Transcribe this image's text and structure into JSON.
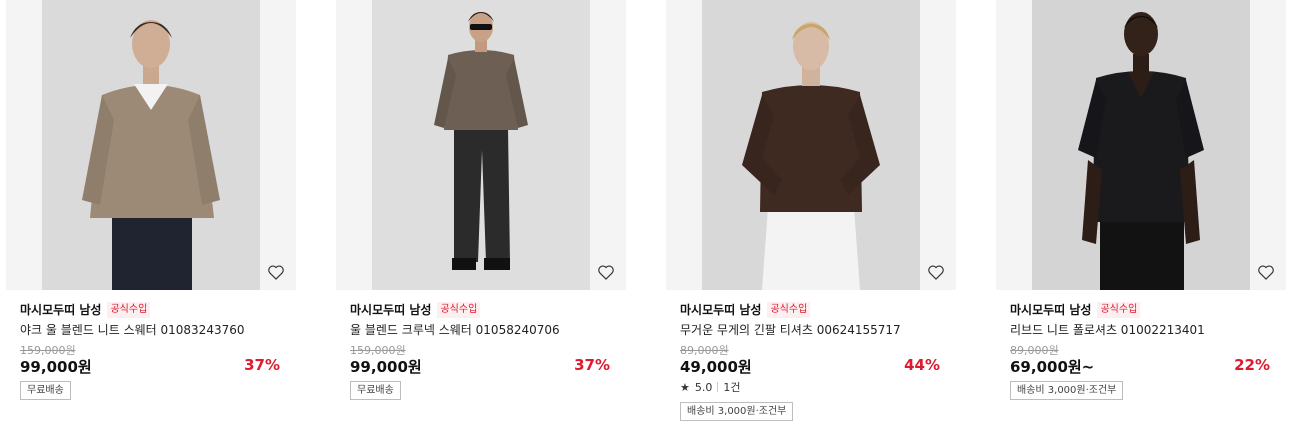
{
  "products": [
    {
      "brand": "마시모두띠 남성",
      "badge": "공식수입",
      "title": "야크 울 블렌드 니트 스웨터 01083243760",
      "original_price": "159,000원",
      "price": "99,000원",
      "discount": "37%",
      "shipping_tag": "무료배송",
      "wishlist_icon": "heart-outline-icon"
    },
    {
      "brand": "마시모두띠 남성",
      "badge": "공식수입",
      "title": "울 블렌드 크루넥 스웨터 01058240706",
      "original_price": "159,000원",
      "price": "99,000원",
      "discount": "37%",
      "shipping_tag": "무료배송",
      "wishlist_icon": "heart-outline-icon"
    },
    {
      "brand": "마시모두띠 남성",
      "badge": "공식수입",
      "title": "무거운 무게의 긴팔 티셔츠 00624155717",
      "original_price": "89,000원",
      "price": "49,000원",
      "discount": "44%",
      "rating": "5.0",
      "review_count": "1건",
      "shipping_tag": "배송비 3,000원·조건부",
      "wishlist_icon": "heart-outline-icon"
    },
    {
      "brand": "마시모두띠 남성",
      "badge": "공식수입",
      "title": "리브드 니트 폴로셔츠 01002213401",
      "original_price": "89,000원",
      "price": "69,000원~",
      "discount": "22%",
      "shipping_tag": "배송비 3,000원·조건부",
      "wishlist_icon": "heart-outline-icon"
    }
  ],
  "colors": {
    "discount": "#e0192e",
    "badge_bg": "#fdeef0",
    "strikethrough": "#9a9a9a"
  }
}
